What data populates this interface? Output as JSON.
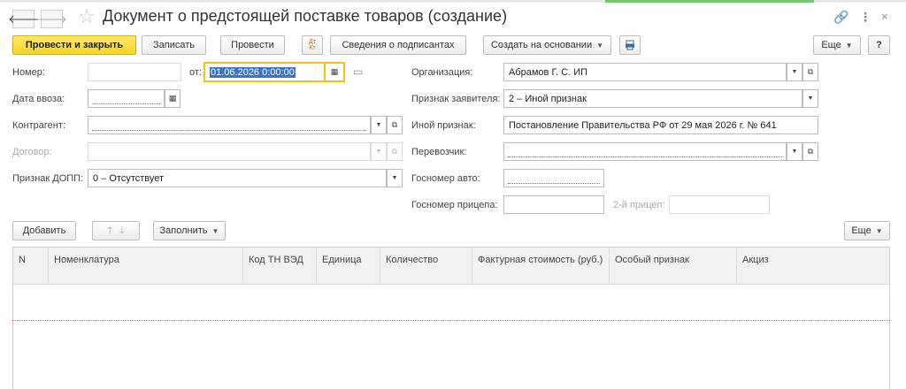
{
  "window": {
    "title": "Документ о предстоящей поставке товаров (создание)",
    "back_glyph": "🡐",
    "forward_glyph": "🡒",
    "star_glyph": "☆",
    "link_glyph": "🔗",
    "more_glyph": "⋮",
    "close_glyph": "×"
  },
  "toolbar": {
    "post_close": "Провести и закрыть",
    "save": "Записать",
    "post": "Провести",
    "dt_kt": "Дт Кт",
    "signers": "Сведения о подписантах",
    "create_based": "Создать на основании",
    "more": "Еще",
    "help": "?"
  },
  "form": {
    "number_label": "Номер:",
    "number_value": "",
    "from_label": "от:",
    "date_value": "01.06.2026  0:00:00",
    "import_date_label": "Дата ввоза:",
    "import_date_value": "",
    "counterparty_label": "Контрагент:",
    "counterparty_value": "",
    "contract_label": "Договор:",
    "contract_value": "",
    "dopp_label": "Признак ДОПП:",
    "dopp_value": "0 – Отсутствует",
    "org_label": "Организация:",
    "org_value": "Абрамов Г. С. ИП",
    "applicant_label": "Признак заявителя:",
    "applicant_value": "2 – Иной признак",
    "other_label": "Иной признак:",
    "other_value": "Постановление Правительства РФ от 29 мая 2026 г. № 641",
    "carrier_label": "Перевозчик:",
    "carrier_value": "",
    "car_plate_label": "Госномер авто:",
    "car_plate_value": "",
    "trailer_label": "Госномер прицепа:",
    "trailer_value": "",
    "trailer2_label": "2-й прицеп:",
    "trailer2_value": ""
  },
  "table_toolbar": {
    "add": "Добавить",
    "fill": "Заполнить",
    "more": "Еще"
  },
  "table": {
    "columns": [
      "N",
      "Номенклатура",
      "Код ТН ВЭД",
      "Единица",
      "Количество",
      "Фактурная стоимость (руб.)",
      "Особый признак",
      "Акциз"
    ],
    "rows": []
  },
  "colors": {
    "primary_button": "#f5d427",
    "active_field_border": "#f5c211",
    "selection": "#3b73c8",
    "required_underline": "#e05050"
  }
}
